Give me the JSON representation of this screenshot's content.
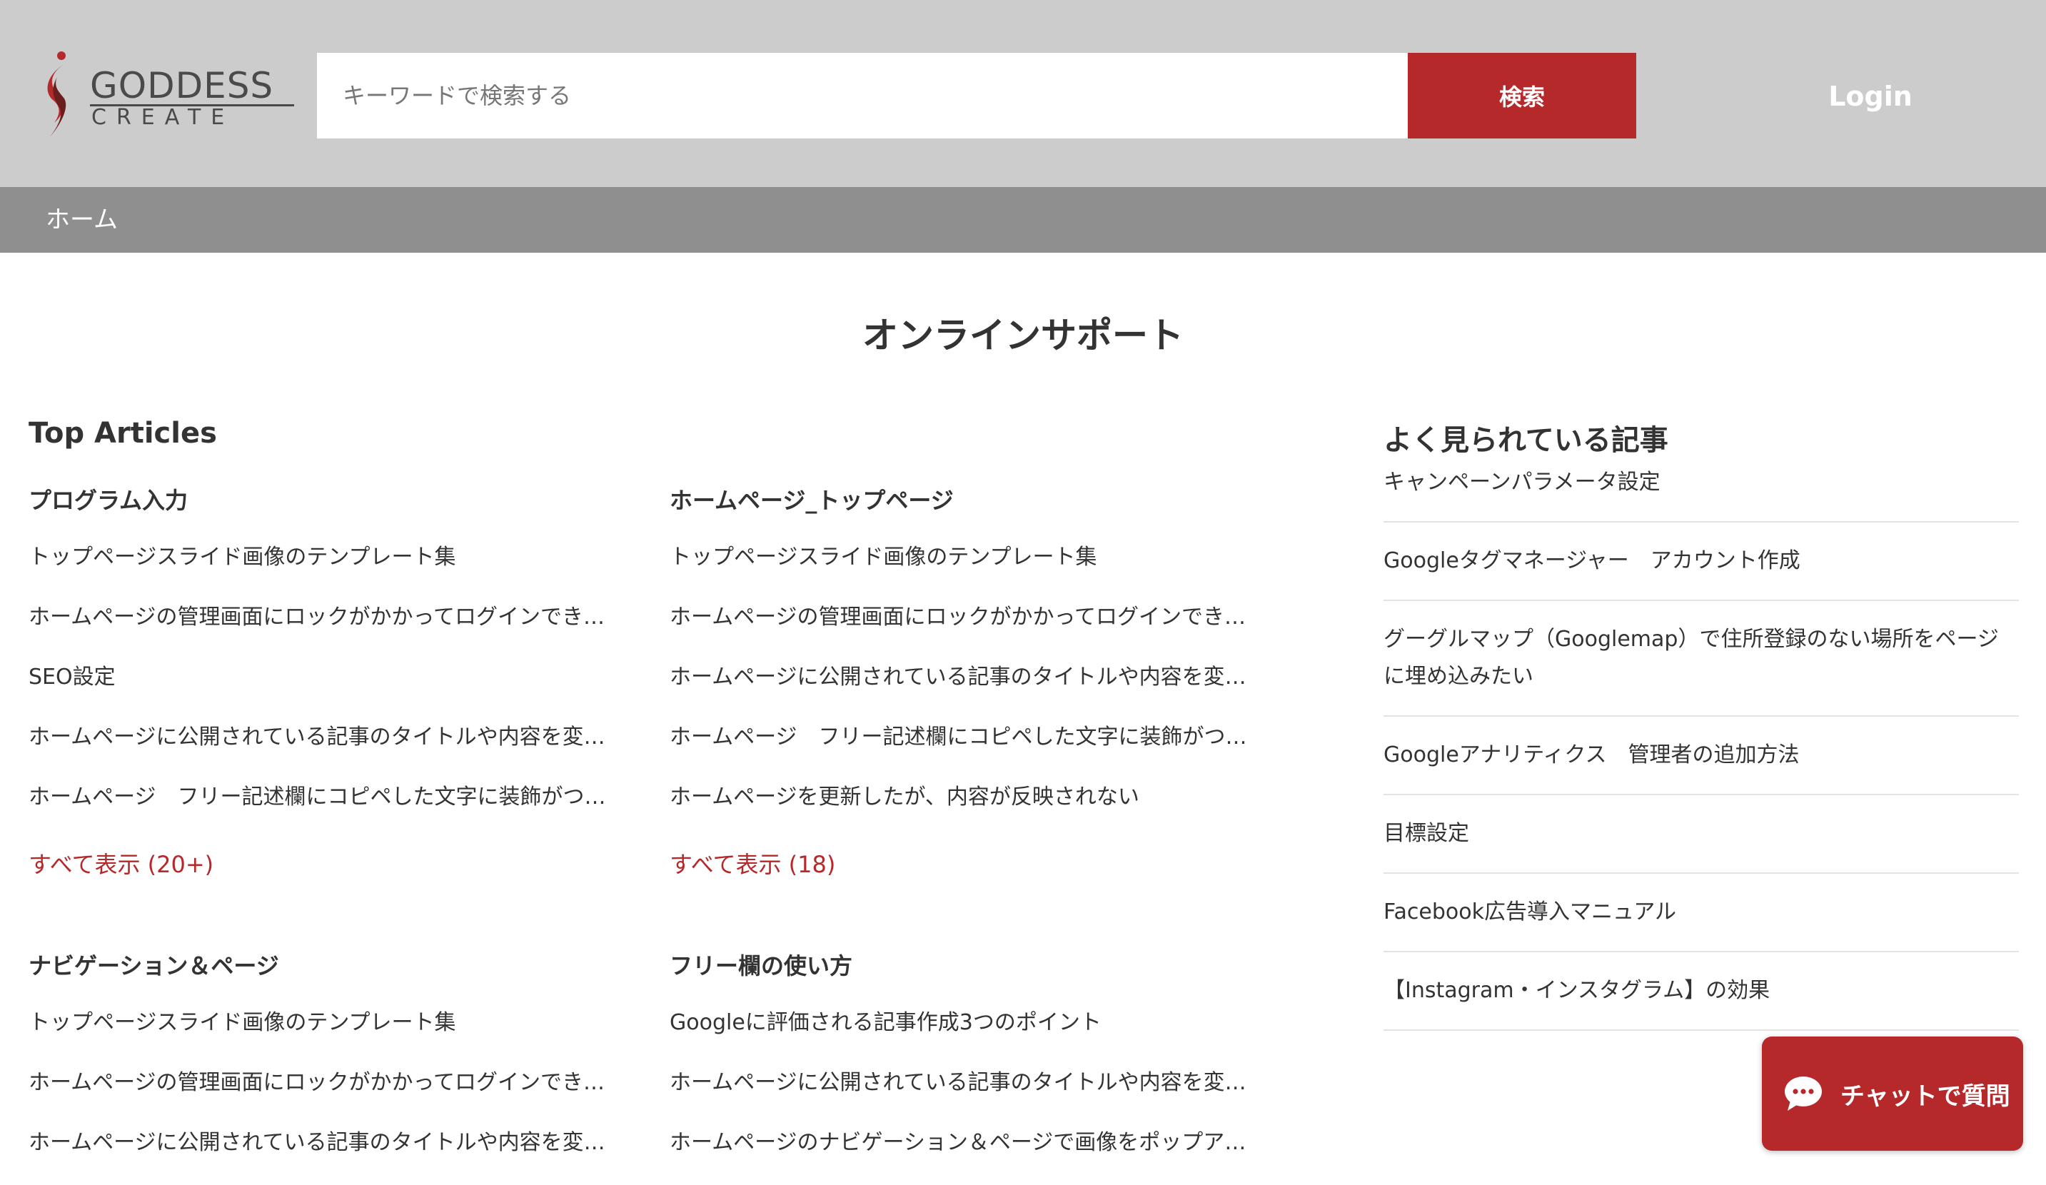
{
  "header": {
    "logo": {
      "word": "GODDESS",
      "sub": "CREATE"
    },
    "search": {
      "placeholder": "キーワードで検索する",
      "button_label": "検索"
    },
    "login_label": "Login"
  },
  "breadcrumb": {
    "home": "ホーム"
  },
  "page_title": "オンラインサポート",
  "top_articles": {
    "heading": "Top Articles",
    "categories": [
      {
        "title": "プログラム入力",
        "articles": [
          "トップページスライド画像のテンプレート集",
          "ホームページの管理画面にロックがかかってログインできない",
          "SEO設定",
          "ホームページに公開されている記事のタイトルや内容を変更したい",
          "ホームページ　フリー記述欄にコピペした文字に装飾がついてしまう"
        ],
        "see_all": "すべて表示 (20+)"
      },
      {
        "title": "ホームページ_トップページ",
        "articles": [
          "トップページスライド画像のテンプレート集",
          "ホームページの管理画面にロックがかかってログインできない",
          "ホームページに公開されている記事のタイトルや内容を変更したい",
          "ホームページ　フリー記述欄にコピペした文字に装飾がついてしまう",
          "ホームページを更新したが、内容が反映されない"
        ],
        "see_all": "すべて表示 (18)"
      },
      {
        "title": "ナビゲーション＆ページ",
        "articles": [
          "トップページスライド画像のテンプレート集",
          "ホームページの管理画面にロックがかかってログインできない",
          "ホームページに公開されている記事のタイトルや内容を変更したい"
        ]
      },
      {
        "title": "フリー欄の使い方",
        "articles": [
          "Googleに評価される記事作成3つのポイント",
          "ホームページに公開されている記事のタイトルや内容を変更したい",
          "ホームページのナビゲーション＆ページで画像をポップアップ"
        ]
      }
    ]
  },
  "popular": {
    "heading": "よく見られている記事",
    "articles": [
      "キャンペーンパラメータ設定",
      "Googleタグマネージャー　アカウント作成",
      "グーグルマップ（Googlemap）で住所登録のない場所をページに埋め込みたい",
      "Googleアナリティクス　管理者の追加方法",
      "目標設定",
      "Facebook広告導入マニュアル",
      "【Instagram・インスタグラム】の効果"
    ]
  },
  "chat": {
    "label": "チャットで質問"
  },
  "colors": {
    "brand_red": "#b5292b",
    "header_bg": "#cccccc",
    "breadcrumb_bg": "#8f8f8f"
  }
}
